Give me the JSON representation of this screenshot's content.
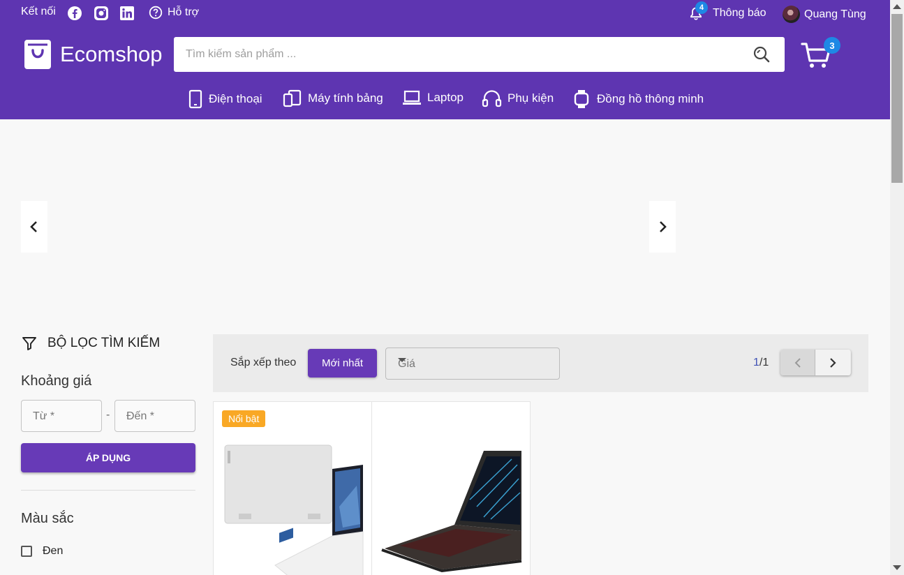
{
  "topbar": {
    "connect_label": "Kết nối",
    "support_label": "Hỗ trợ",
    "notifications_label": "Thông báo",
    "notifications_count": "4",
    "user_name": "Quang Tùng",
    "social_icons": [
      "facebook-icon",
      "instagram-icon",
      "linkedin-icon"
    ]
  },
  "brand": {
    "name": "Ecomshop",
    "accent_color": "#5e35b1"
  },
  "search": {
    "placeholder": "Tìm kiếm sản phẩm ..."
  },
  "cart": {
    "count": "3"
  },
  "nav": {
    "items": [
      {
        "label": "Điện thoại",
        "icon": "phone-icon"
      },
      {
        "label": "Máy tính bảng",
        "icon": "tablet-icon"
      },
      {
        "label": "Laptop",
        "icon": "laptop-icon"
      },
      {
        "label": "Phụ kiện",
        "icon": "headphones-icon"
      },
      {
        "label": "Đồng hồ thông minh",
        "icon": "smartwatch-icon"
      }
    ]
  },
  "filter": {
    "title": "BỘ LỌC TÌM KIẾM",
    "price_title": "Khoảng giá",
    "from_placeholder": "Từ *",
    "to_placeholder": "Đến *",
    "dash": "-",
    "apply_label": "ÁP DỤNG",
    "color_title": "Màu sắc",
    "colors": [
      "Đen"
    ]
  },
  "sort": {
    "label": "Sắp xếp theo",
    "newest_label": "Mới nhất",
    "price_placeholder": "Giá",
    "page_current": "1",
    "page_total": "/1"
  },
  "products": [
    {
      "badge": "Nổi bật"
    },
    {
      "badge": ""
    }
  ]
}
